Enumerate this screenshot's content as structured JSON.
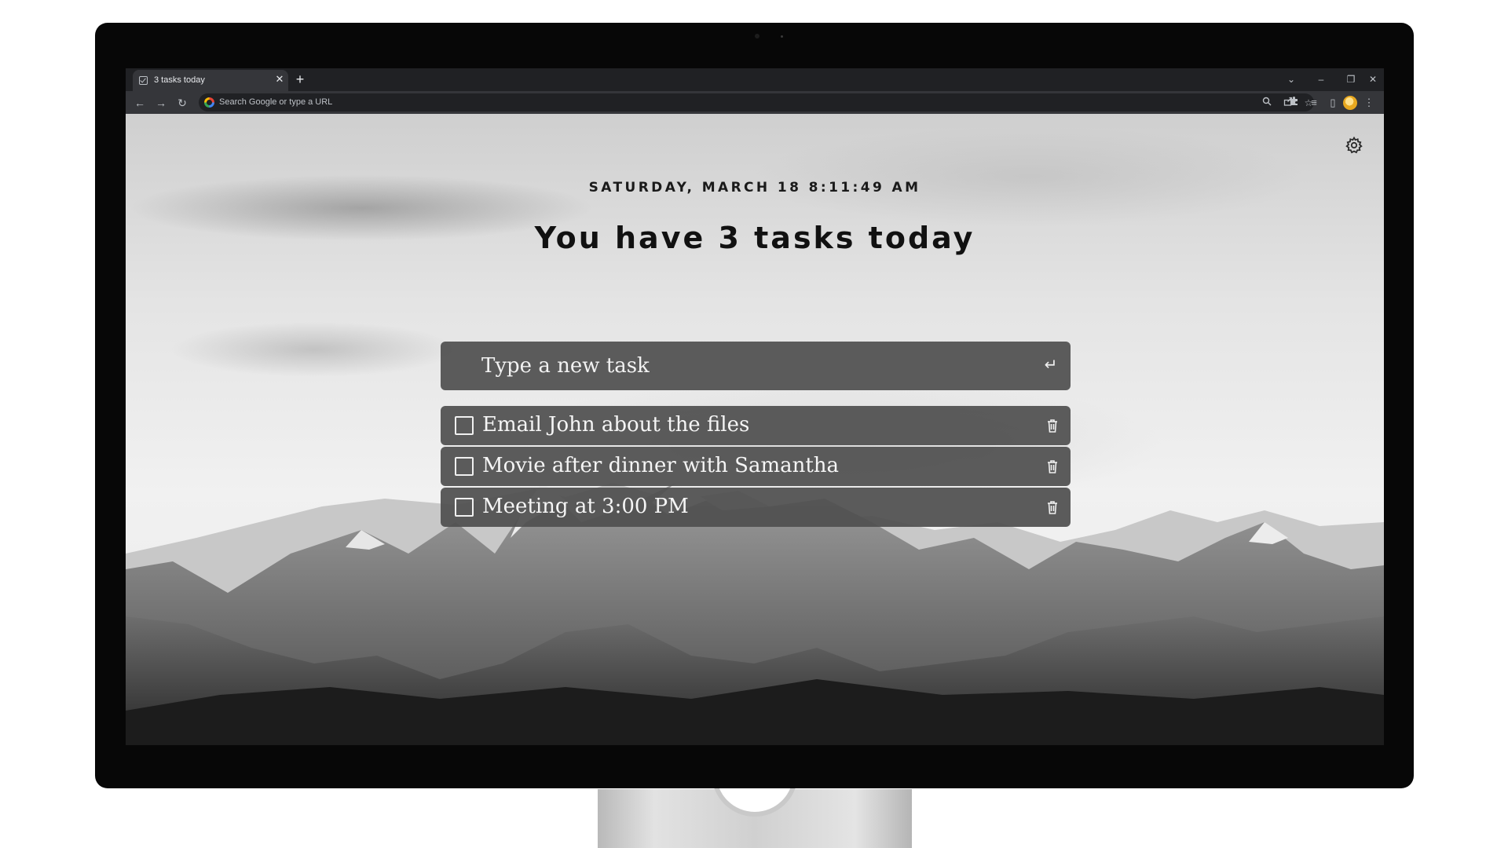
{
  "browser": {
    "tab": {
      "title": "3 tasks today",
      "favicon": "checkbox-icon",
      "close": "✕"
    },
    "new_tab": "+",
    "window_controls": {
      "tab_search": "⌄",
      "minimize": "–",
      "restore": "❐",
      "close": "✕"
    },
    "nav": {
      "back": "←",
      "forward": "→",
      "reload": "↻"
    },
    "omnibox": {
      "placeholder": "Search Google or type a URL",
      "zoom": "zoom-icon",
      "share": "share-icon",
      "bookmark": "☆"
    },
    "toolbar_icons": {
      "extensions": "puzzle-icon",
      "media": "≡",
      "side_panel": "▯",
      "menu": "⋮"
    }
  },
  "page": {
    "datetime": "SATURDAY, MARCH 18 8:11:49 AM",
    "headline": "You have 3 tasks today",
    "new_task_placeholder": "Type a new task",
    "enter_symbol": "↵",
    "tasks": [
      {
        "label": "Email John about the files",
        "done": false
      },
      {
        "label": "Movie after dinner with Samantha",
        "done": false
      },
      {
        "label": "Meeting at 3:00 PM",
        "done": false
      }
    ]
  },
  "colors": {
    "chrome_dark": "#202124",
    "chrome_toolbar": "#35363a",
    "task_panel": "#505050",
    "text_dark": "#111111",
    "text_light": "#f5f5f5"
  }
}
